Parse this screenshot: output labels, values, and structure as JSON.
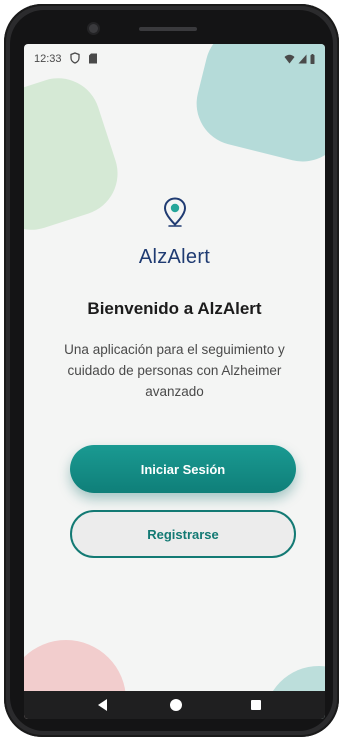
{
  "status_bar": {
    "time": "12:33",
    "icons_left": [
      "shield-icon",
      "sd-card-icon"
    ],
    "icons_right": [
      "wifi-icon",
      "signal-icon",
      "battery-icon"
    ]
  },
  "brand": {
    "name": "AlzAlert",
    "logo_icon": "location-pin-icon",
    "primary_color": "#137a74",
    "text_color": "#1f3b72"
  },
  "welcome": {
    "title": "Bienvenido a AlzAlert",
    "description": "Una aplicación para el seguimiento y cuidado de personas con Alzheimer avanzado"
  },
  "actions": {
    "login_label": "Iniciar Sesión",
    "register_label": "Registrarse"
  },
  "navigation": {
    "buttons": [
      "back-icon",
      "home-icon",
      "recents-icon"
    ]
  }
}
